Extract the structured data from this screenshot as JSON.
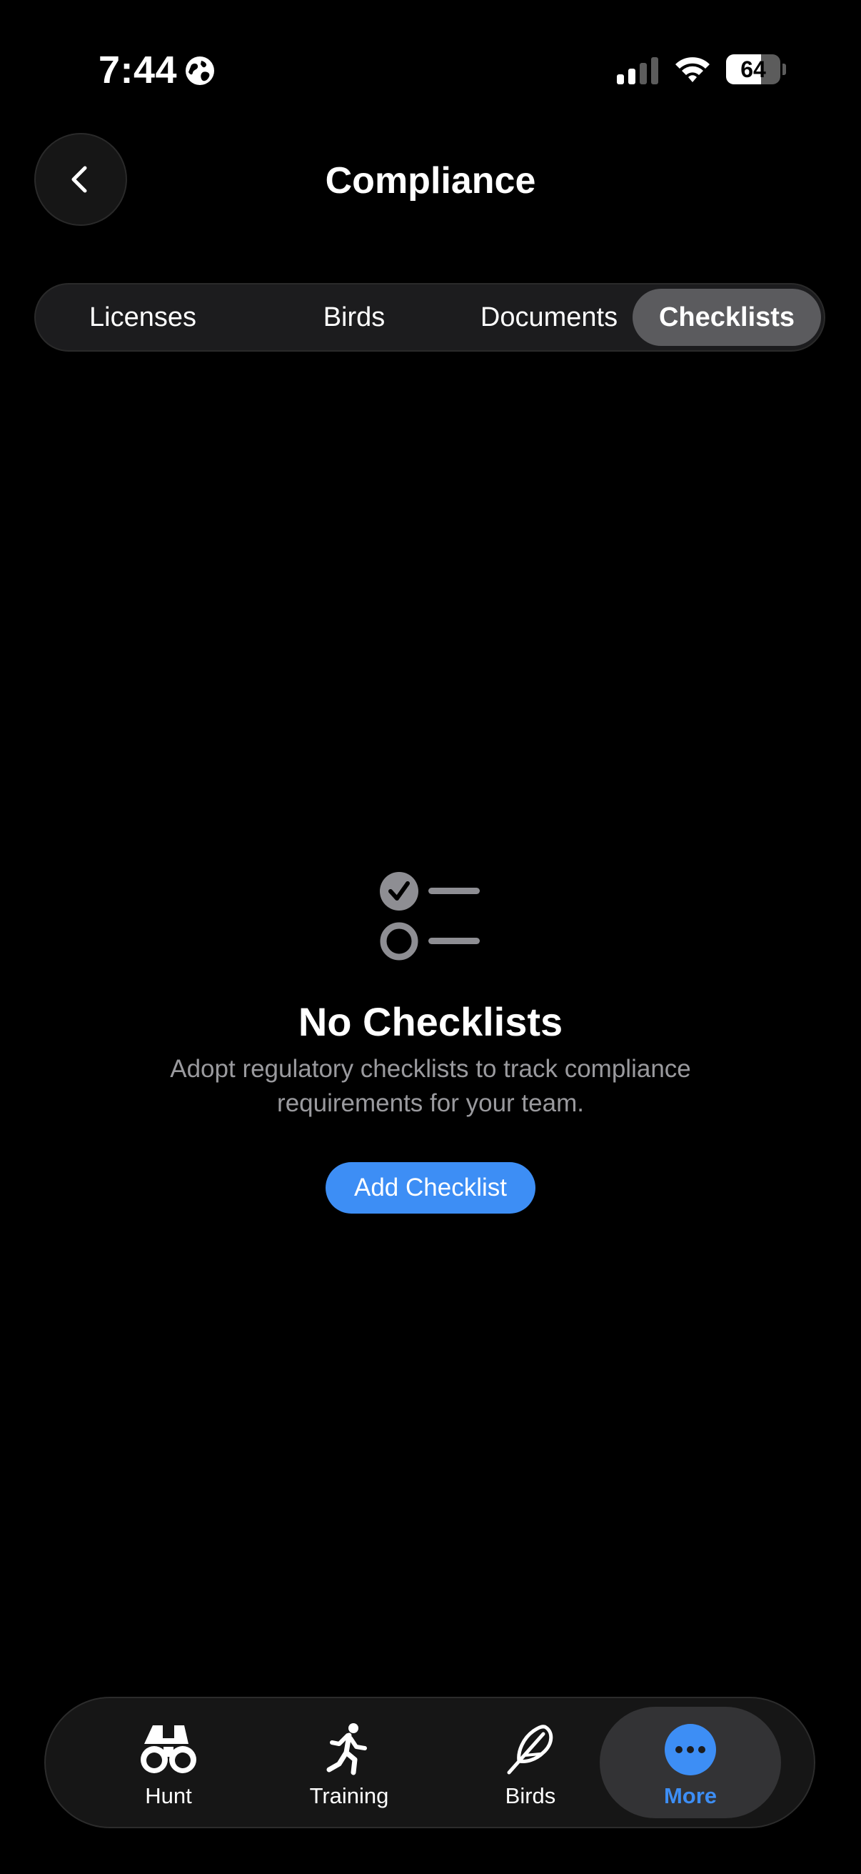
{
  "status_bar": {
    "time": "7:44",
    "battery_level": 64,
    "battery_label": "64"
  },
  "header": {
    "title": "Compliance"
  },
  "tabs": [
    {
      "label": "Licenses",
      "active": false
    },
    {
      "label": "Birds",
      "active": false
    },
    {
      "label": "Documents",
      "active": false
    },
    {
      "label": "Checklists",
      "active": true
    }
  ],
  "empty_state": {
    "icon": "checklist-icon",
    "title": "No Checklists",
    "description": "Adopt regulatory checklists to track compliance requirements for your team.",
    "button_label": "Add Checklist"
  },
  "tab_bar": {
    "items": [
      {
        "label": "Hunt",
        "icon": "binoculars-icon",
        "active": false
      },
      {
        "label": "Training",
        "icon": "running-figure-icon",
        "active": false
      },
      {
        "label": "Birds",
        "icon": "feather-icon",
        "active": false
      },
      {
        "label": "More",
        "icon": "more-icon",
        "active": true
      }
    ]
  },
  "colors": {
    "background": "#000000",
    "accent": "#3d8ef5",
    "secondary_text": "#9a9a9e",
    "active_tab": "#5b5b5e"
  }
}
